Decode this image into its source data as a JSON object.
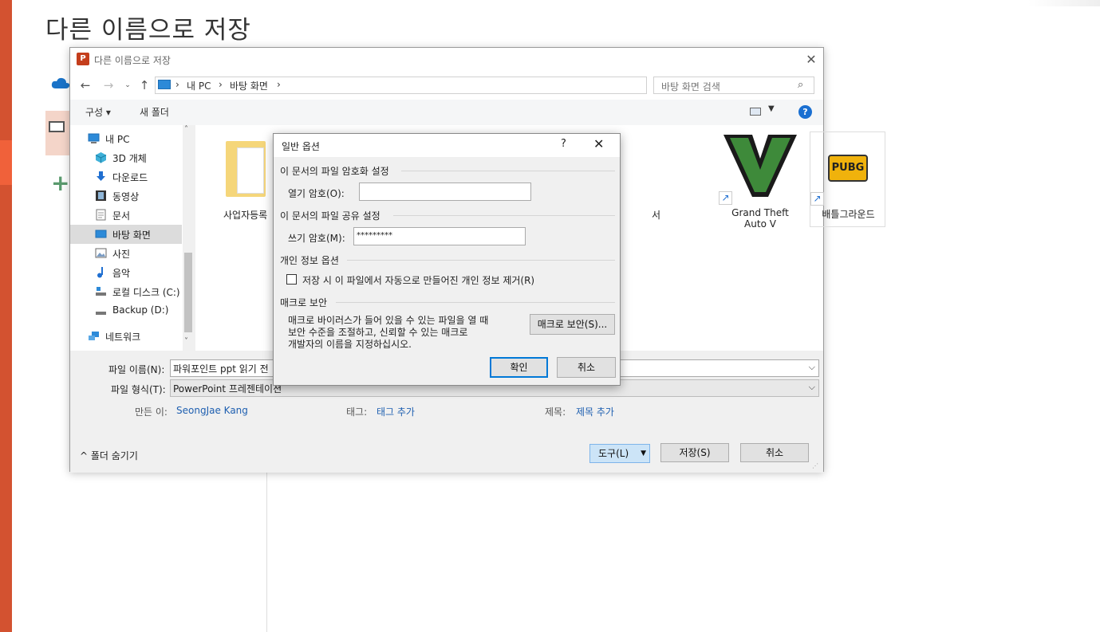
{
  "backstage": {
    "title": "다른 이름으로 저장"
  },
  "save_dialog": {
    "title": "다른 이름으로 저장",
    "app_icon_text": "P",
    "address": {
      "crumbs": [
        "내 PC",
        "바탕 화면"
      ]
    },
    "search": {
      "placeholder": "바탕 화면 검색"
    },
    "toolbar": {
      "organize": "구성 ▾",
      "new_folder": "새 폴더",
      "help": "?"
    },
    "nav_items": [
      {
        "label": "내 PC",
        "icon": "pc-icon"
      },
      {
        "label": "3D 개체",
        "icon": "cube-icon"
      },
      {
        "label": "다운로드",
        "icon": "download-icon"
      },
      {
        "label": "동영상",
        "icon": "video-icon"
      },
      {
        "label": "문서",
        "icon": "document-icon"
      },
      {
        "label": "바탕 화면",
        "icon": "desktop-icon",
        "selected": true
      },
      {
        "label": "사진",
        "icon": "picture-icon"
      },
      {
        "label": "음악",
        "icon": "music-icon"
      },
      {
        "label": "로컬 디스크 (C:)",
        "icon": "drive-icon"
      },
      {
        "label": "Backup (D:)",
        "icon": "drive-icon"
      },
      {
        "label": "네트워크",
        "icon": "network-icon"
      }
    ],
    "files": [
      {
        "label": "사업자등록"
      },
      {
        "label": "서"
      },
      {
        "label": "Grand Theft Auto V"
      },
      {
        "label": "배틀그라운드",
        "logo_text": "PUBG"
      }
    ],
    "filename_label": "파일 이름(N):",
    "filename_value": "파워포인트 ppt 읽기 전",
    "filetype_label": "파일 형식(T):",
    "filetype_value": "PowerPoint 프레젠테이션",
    "author_label": "만든 이:",
    "author_value": "SeongJae Kang",
    "tags_label": "태그:",
    "tags_value": "태그 추가",
    "subject_label": "제목:",
    "subject_value": "제목 추가",
    "hide_folders": "^  폴더 숨기기",
    "tools_button": "도구(L)",
    "save_button": "저장(S)",
    "cancel_button": "취소"
  },
  "general_options": {
    "title": "일반 옵션",
    "help": "?",
    "encrypt_section": "이 문서의 파일 암호화 설정",
    "open_password_label": "열기 암호(O):",
    "open_password_value": "",
    "share_section": "이 문서의 파일 공유 설정",
    "modify_password_label": "쓰기 암호(M):",
    "modify_password_value": "*********",
    "privacy_section": "개인 정보 옵션",
    "privacy_checkbox_label": "저장 시 이 파일에서 자동으로 만들어진 개인 정보 제거(R)",
    "privacy_checked": false,
    "macro_section": "매크로 보안",
    "macro_text_line1": "매크로 바이러스가 들어 있을 수 있는 파일을 열 때",
    "macro_text_line2": "보안 수준을 조절하고, 신뢰할 수 있는 매크로",
    "macro_text_line3": "개발자의 이름을 지정하십시오.",
    "macro_button": "매크로 보안(S)...",
    "ok_button": "확인",
    "cancel_button": "취소"
  }
}
